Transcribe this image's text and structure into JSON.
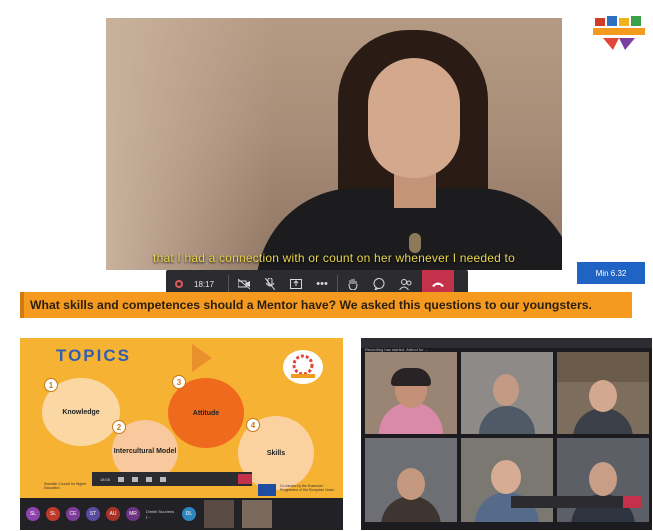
{
  "main_video": {
    "subtitle": "that I had a connection with or count on her whenever I needed to"
  },
  "control_bar": {
    "timer": "18:17",
    "buttons": [
      "camera-icon",
      "mic-off-icon",
      "share-icon",
      "more-icon",
      "raise-hand-icon",
      "chat-icon",
      "participants-icon",
      "hang-up-icon"
    ]
  },
  "min_badge": "Min 6.32",
  "banner": {
    "text": "What skills and competences should a Mentor have? We asked this questions to our youngsters."
  },
  "topics_slide": {
    "title": "TOPICS",
    "items": [
      {
        "number": "1",
        "label": "Knowledge"
      },
      {
        "number": "2",
        "label": "Intercultural Model"
      },
      {
        "number": "3",
        "label": "Attitude"
      },
      {
        "number": "4",
        "label": "Skills"
      }
    ],
    "mini_timer": "18:05",
    "footer_left": "Swedish Council for Higher Education",
    "footer_right": "Co-funded by the Erasmus+ Programme of the European Union"
  },
  "participants_bar": {
    "avatars": [
      {
        "initials": "SL",
        "color": "#8e44ad"
      },
      {
        "initials": "SL",
        "color": "#c0392b"
      },
      {
        "initials": "CE",
        "color": "#7d3c98"
      },
      {
        "initials": "ST",
        "color": "#5b4ba0"
      },
      {
        "initials": "AU",
        "color": "#a93226"
      },
      {
        "initials": "MR",
        "color": "#6c3483"
      },
      {
        "initials": "DL",
        "color": "#2e86c1"
      }
    ],
    "name_label": "Dimitri Sourleris (..."
  },
  "gallery": {
    "top_text": "Recording has started. Attend for ..."
  }
}
